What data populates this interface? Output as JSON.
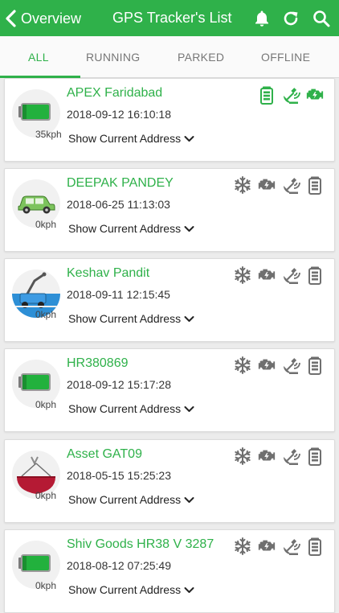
{
  "header": {
    "back_label": "Overview",
    "title": "GPS Tracker's List"
  },
  "tabs": [
    {
      "label": "ALL",
      "active": true
    },
    {
      "label": "RUNNING",
      "active": false
    },
    {
      "label": "PARKED",
      "active": false
    },
    {
      "label": "OFFLINE",
      "active": false
    }
  ],
  "colors": {
    "brand": "#2fb14a",
    "inactive_icon": "#6f6f6f",
    "battery_fill": "#22b13d"
  },
  "trackers": [
    {
      "name": "APEX Faridabad",
      "datetime": "2018-09-12 16:10:18",
      "speed": "35kph",
      "address_label": "Show Current Address",
      "vehicle_icon": "battery-vehicle-icon",
      "status_icons": [
        "battery-icon",
        "satellite-icon",
        "engine-icon"
      ],
      "status_active": true
    },
    {
      "name": "DEEPAK PANDEY",
      "datetime": "2018-06-25 11:13:03",
      "speed": "0kph",
      "address_label": "Show Current Address",
      "vehicle_icon": "car-icon",
      "status_icons": [
        "ac-icon",
        "engine-icon",
        "satellite-icon",
        "battery-icon"
      ],
      "status_active": false
    },
    {
      "name": "Keshav Pandit",
      "datetime": "2018-09-11 12:15:45",
      "speed": "0kph",
      "address_label": "Show Current Address",
      "vehicle_icon": "forklift-icon",
      "status_icons": [
        "ac-icon",
        "engine-icon",
        "satellite-icon",
        "battery-icon"
      ],
      "status_active": false
    },
    {
      "name": "HR380869",
      "datetime": "2018-09-12 15:17:28",
      "speed": "0kph",
      "address_label": "Show Current Address",
      "vehicle_icon": "battery-vehicle-icon",
      "status_icons": [
        "ac-icon",
        "engine-icon",
        "satellite-icon",
        "battery-icon"
      ],
      "status_active": false
    },
    {
      "name": "Asset GAT09",
      "datetime": "2018-05-15 15:25:23",
      "speed": "0kph",
      "address_label": "Show Current Address",
      "vehicle_icon": "crane-bucket-icon",
      "status_icons": [
        "ac-icon",
        "engine-icon",
        "satellite-icon",
        "battery-icon"
      ],
      "status_active": false
    },
    {
      "name": "Shiv Goods HR38 V 3287",
      "datetime": "2018-08-12 07:25:49",
      "speed": "0kph",
      "address_label": "Show Current Address",
      "vehicle_icon": "battery-vehicle-icon",
      "status_icons": [
        "ac-icon",
        "engine-icon",
        "satellite-icon",
        "battery-icon"
      ],
      "status_active": false
    }
  ]
}
